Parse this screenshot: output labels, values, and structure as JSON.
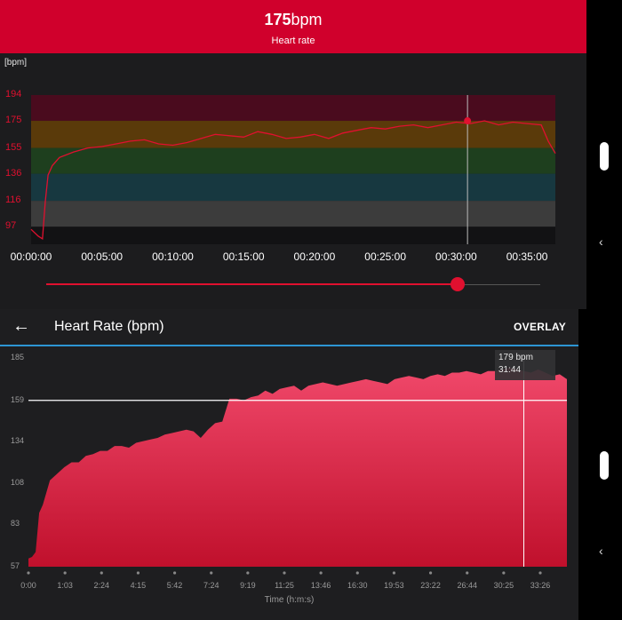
{
  "top_panel": {
    "current_value": "175",
    "current_unit": "bpm",
    "subtitle": "Heart rate",
    "unit_tag": "[bpm]"
  },
  "bottom_panel": {
    "back_label": "←",
    "title": "Heart Rate (bpm)",
    "overlay_label": "OVERLAY",
    "tooltip_value": "179 bpm",
    "tooltip_time": "31:44"
  },
  "nav": {
    "back_glyph": "‹"
  },
  "colors": {
    "header_red": "#d0002c",
    "line_red": "#e0102f",
    "accent_blue": "#2d95d4",
    "area_top": "#f0486a",
    "area_bottom": "#c0102c"
  },
  "chart_data": [
    {
      "type": "line",
      "title": "",
      "yticks": [
        "194",
        "175",
        "155",
        "136",
        "116",
        "97"
      ],
      "xticks": [
        "00:00:00",
        "00:05:00",
        "00:10:00",
        "00:15:00",
        "00:20:00",
        "00:25:00",
        "00:30:00",
        "00:35:00"
      ],
      "ylim": [
        84,
        194
      ],
      "xlim": [
        0,
        37
      ],
      "zones": [
        {
          "from": 175,
          "to": 194,
          "color": "#4a0b1e"
        },
        {
          "from": 155,
          "to": 175,
          "color": "#5a3a0a"
        },
        {
          "from": 136,
          "to": 155,
          "color": "#1e3f1e"
        },
        {
          "from": 116,
          "to": 136,
          "color": "#173840"
        },
        {
          "from": 97,
          "to": 116,
          "color": "#3c3c3c"
        }
      ],
      "series": [
        {
          "x": [
            0,
            0.5,
            0.8,
            1,
            1.2,
            1.5,
            2,
            3,
            4,
            5,
            6,
            7,
            8,
            9,
            10,
            11,
            12,
            13,
            14,
            15,
            16,
            17,
            18,
            19,
            20,
            21,
            22,
            23,
            24,
            25,
            26,
            27,
            28,
            29,
            30,
            31,
            32,
            33,
            34,
            35,
            36,
            36.5,
            37
          ],
          "y": [
            95,
            90,
            88,
            115,
            135,
            142,
            148,
            152,
            155,
            156,
            158,
            160,
            161,
            158,
            157,
            159,
            162,
            165,
            164,
            163,
            167,
            165,
            162,
            163,
            165,
            162,
            166,
            168,
            170,
            169,
            171,
            172,
            170,
            172,
            174,
            173,
            175,
            172,
            174,
            173,
            172,
            160,
            151
          ]
        }
      ],
      "marker": {
        "x": 30.8,
        "y": 175
      }
    },
    {
      "type": "area",
      "title": "",
      "xlabel": "Time (h:m:s)",
      "yticks": [
        "185",
        "159",
        "134",
        "108",
        "83",
        "57"
      ],
      "xticks": [
        "0:00",
        "1:03",
        "2:24",
        "4:15",
        "5:42",
        "7:24",
        "9:19",
        "11:25",
        "13:46",
        "16:30",
        "19:53",
        "23:22",
        "26:44",
        "30:25",
        "33:26"
      ],
      "ylim": [
        57,
        185
      ],
      "reference_line": 159,
      "series": [
        {
          "x": [
            0,
            0.5,
            1,
            1.5,
            2,
            3,
            4,
            5,
            6,
            7,
            8,
            9,
            10,
            11,
            12,
            13,
            14,
            15,
            16,
            17,
            18,
            19,
            20,
            21,
            22,
            23,
            24,
            25,
            26,
            27,
            28,
            29,
            30,
            31,
            32,
            33,
            34,
            35,
            36,
            37,
            38,
            39,
            40,
            41,
            42,
            43,
            44,
            45,
            46,
            47,
            48,
            49,
            50,
            51,
            52,
            53,
            54,
            55,
            56,
            57,
            58,
            59,
            60,
            61,
            62,
            63,
            64,
            65,
            66,
            67,
            68,
            69,
            70,
            71,
            72,
            73,
            74,
            75
          ],
          "y": [
            62,
            63,
            66,
            90,
            95,
            110,
            114,
            118,
            121,
            121,
            125,
            126,
            128,
            128,
            131,
            131,
            130,
            133,
            134,
            135,
            136,
            138,
            139,
            140,
            141,
            140,
            136,
            141,
            145,
            146,
            160,
            160,
            159,
            161,
            162,
            165,
            163,
            166,
            167,
            168,
            165,
            168,
            169,
            170,
            169,
            168,
            169,
            170,
            171,
            172,
            171,
            170,
            169,
            172,
            173,
            174,
            173,
            172,
            174,
            175,
            174,
            176,
            176,
            177,
            176,
            175,
            177,
            177,
            178,
            179,
            178,
            177,
            176,
            178,
            176,
            174,
            175,
            172
          ]
        }
      ],
      "cursor": {
        "x": 69,
        "value": 179
      }
    }
  ]
}
